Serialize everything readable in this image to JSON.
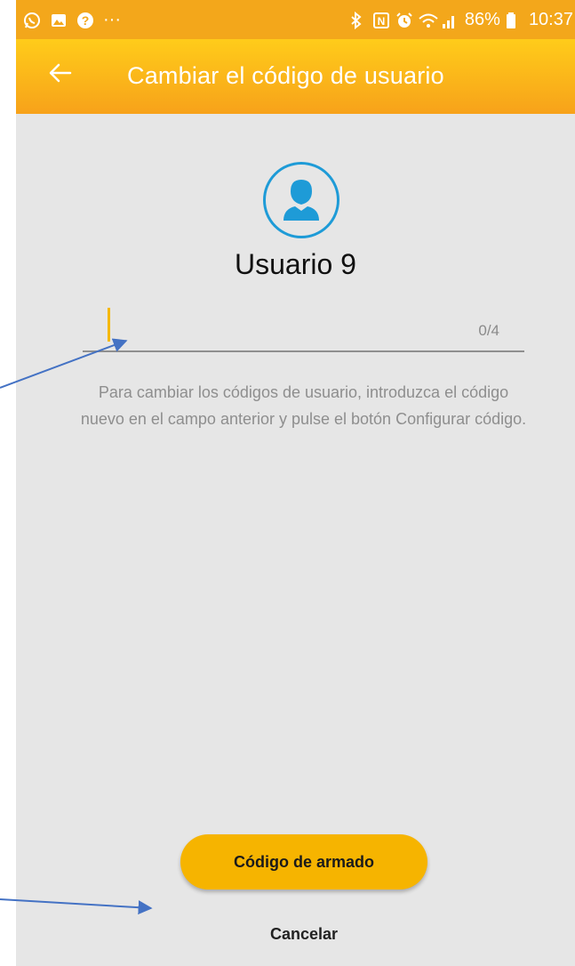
{
  "status_bar": {
    "left_icons": [
      "whatsapp-icon",
      "gallery-icon",
      "help-icon"
    ],
    "more": "···",
    "battery": "86%",
    "time": "10:37",
    "right_icons": [
      "bluetooth-icon",
      "nfc-icon",
      "alarm-icon",
      "wifi-icon",
      "signal-icon",
      "battery-icon"
    ]
  },
  "app_bar": {
    "back_icon": "arrow-left-icon",
    "title": "Cambiar el código de usuario"
  },
  "user": {
    "avatar_icon": "user-icon",
    "name": "Usuario 9"
  },
  "code_field": {
    "value": "",
    "counter": "0/4"
  },
  "help_text": "Para cambiar los códigos de usuario, introduzca el código nuevo en el campo anterior y pulse el botón Configurar código.",
  "actions": {
    "primary": "Código de armado",
    "cancel": "Cancelar"
  },
  "colors": {
    "accent": "#f6b400",
    "app_bar": "#f7a21a",
    "avatar": "#1e9bd7",
    "annotation_arrow": "#4472c4"
  }
}
